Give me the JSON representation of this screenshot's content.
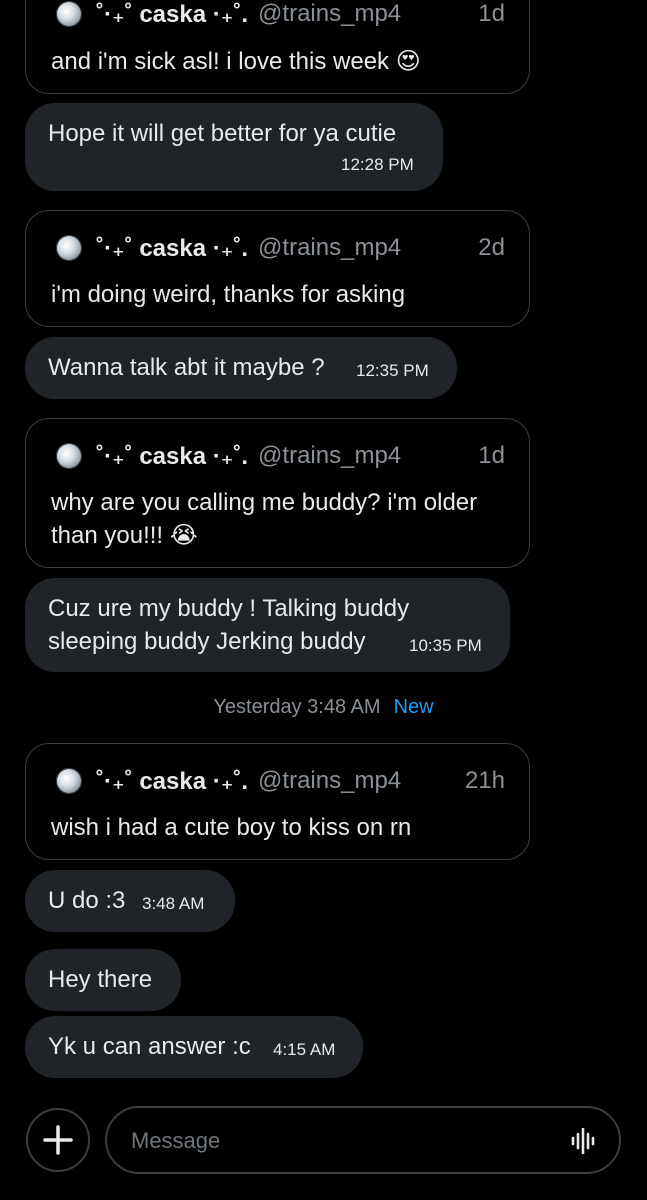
{
  "messages": [
    {
      "type": "quote",
      "display_name": "˚·₊˚ caska ·₊˚.",
      "handle": "@trains_mp4",
      "age": "1d",
      "text": "and i'm sick asl! i love this week 😍"
    },
    {
      "type": "reply",
      "lines": [
        "Hope it will get better for ya cutie"
      ],
      "time": "12:28 PM"
    },
    {
      "type": "quote",
      "display_name": "˚·₊˚ caska ·₊˚.",
      "handle": "@trains_mp4",
      "age": "2d",
      "text": "i'm doing weird, thanks for asking"
    },
    {
      "type": "reply",
      "lines": [
        "Wanna talk abt it maybe ?"
      ],
      "time": "12:35 PM"
    },
    {
      "type": "quote",
      "display_name": "˚·₊˚ caska ·₊˚.",
      "handle": "@trains_mp4",
      "age": "1d",
      "lines": [
        "why are you calling me buddy? i'm older",
        "than you!!! 😭"
      ]
    },
    {
      "type": "reply",
      "lines": [
        "Cuz ure my buddy ! Talking buddy",
        "sleeping buddy Jerking buddy"
      ],
      "time": "10:35 PM"
    },
    {
      "type": "divider",
      "timestamp": "Yesterday 3:48 AM",
      "badge": "New"
    },
    {
      "type": "quote",
      "display_name": "˚·₊˚ caska ·₊˚.",
      "handle": "@trains_mp4",
      "age": "21h",
      "text": "wish i had a cute boy to kiss on rn"
    },
    {
      "type": "reply",
      "lines": [
        "U do :3"
      ],
      "time": "3:48 AM"
    },
    {
      "type": "reply",
      "lines": [
        "Hey there"
      ],
      "time": ""
    },
    {
      "type": "reply",
      "lines": [
        "Yk u can answer :c"
      ],
      "time": "4:15 AM"
    }
  ],
  "composer": {
    "placeholder": "Message",
    "add_icon": "plus-icon",
    "voice_icon": "voice-wave-icon"
  },
  "colors": {
    "background": "#000000",
    "bubble": "#202327",
    "border": "#3a3d41",
    "text": "#e7e9ea",
    "muted": "#8b9096",
    "accent": "#1d9bf0"
  }
}
